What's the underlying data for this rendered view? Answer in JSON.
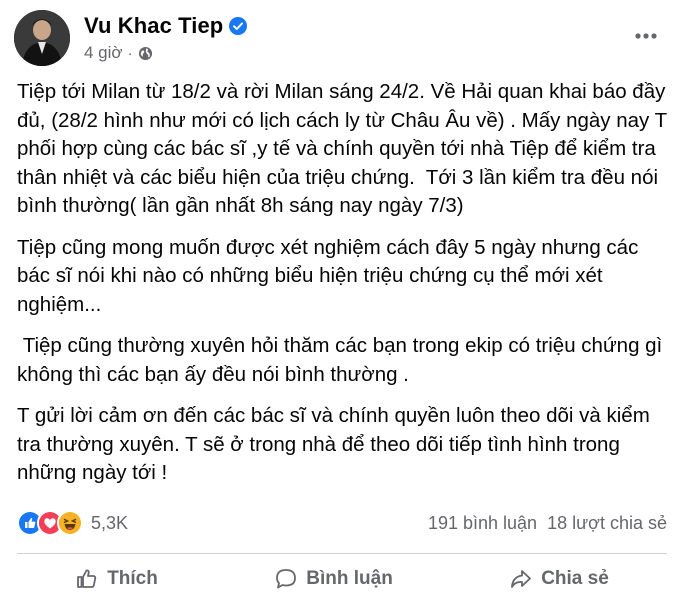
{
  "post": {
    "author": "Vu Khac Tiep",
    "time": "4 giờ",
    "separator": "·",
    "verified": true,
    "icons": {
      "verified": "verified-badge-icon",
      "privacy": "globe-icon",
      "more": "more-dots-icon"
    },
    "paragraphs": [
      "Tiệp tới Milan từ 18/2 và rời Milan sáng 24/2. Về Hải quan khai báo đầy đủ, (28/2 hình như mới có lịch cách ly từ Châu Âu về) . Mấy ngày nay T phối hợp cùng các bác sĩ ,y tế và chính quyền tới nhà Tiệp để kiểm tra thân nhiệt và các biểu hiện của triệu chứng.  Tới 3 lần kiểm tra đều nói bình thường( lần gần nhất 8h sáng nay ngày 7/3)",
      "Tiệp cũng mong muốn được xét nghiệm cách đây 5 ngày nhưng các bác sĩ nói khi nào có những biểu hiện triệu chứng cụ thể mới xét nghiệm...",
      " Tiệp cũng thường xuyên hỏi thăm các bạn trong ekip có triệu chứng gì không thì các bạn ấy đều nói bình thường .",
      "T gửi lời cảm ơn đến các bác sĩ và chính quyền luôn theo dõi và kiểm tra thường xuyên. T sẽ ở trong nhà để theo dõi tiếp tình hình trong những ngày tới !"
    ]
  },
  "stats": {
    "reactions": [
      "like",
      "love",
      "haha"
    ],
    "reaction_count": "5,3K",
    "comments": "191 bình luận",
    "shares": "18 lượt chia sẻ"
  },
  "actions": {
    "like": "Thích",
    "comment": "Bình luận",
    "share": "Chia sẻ"
  },
  "colors": {
    "text": "#050505",
    "secondary": "#65676b",
    "verified": "#1877f2",
    "like": "#1877f2",
    "love": "#f33e58",
    "haha": "#f7b125",
    "divider": "#ced0d4"
  }
}
